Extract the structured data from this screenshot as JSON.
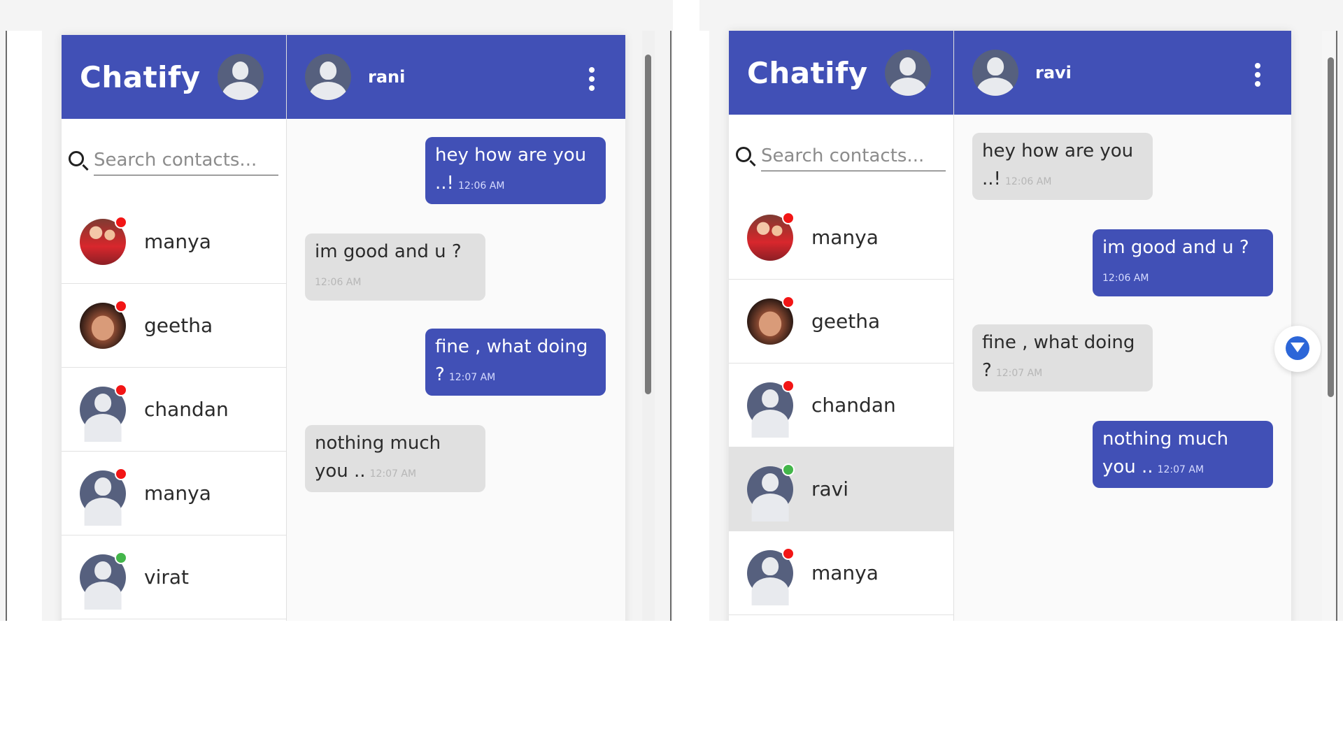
{
  "windows": [
    {
      "app": {
        "title": "Chatify",
        "search_placeholder": "Search contacts...",
        "chat_name": "rani",
        "contacts": [
          {
            "name": "manya",
            "status": "offline",
            "avatar": "photo-a"
          },
          {
            "name": "geetha",
            "status": "offline",
            "avatar": "photo-b"
          },
          {
            "name": "chandan",
            "status": "offline",
            "avatar": "default"
          },
          {
            "name": "manya",
            "status": "offline",
            "avatar": "default"
          },
          {
            "name": "virat",
            "status": "online",
            "avatar": "default"
          }
        ],
        "messages": [
          {
            "text": "hey how are you ..!",
            "time": "12:06 AM",
            "side": "sent"
          },
          {
            "text": "im good and u ?",
            "time": "12:06 AM",
            "side": "recv"
          },
          {
            "text": "fine , what doing ?",
            "time": "12:07 AM",
            "side": "sent"
          },
          {
            "text": "nothing much you ..",
            "time": "12:07 AM",
            "side": "recv"
          }
        ]
      }
    },
    {
      "app": {
        "title": "Chatify",
        "search_placeholder": "Search contacts...",
        "chat_name": "ravi",
        "contacts": [
          {
            "name": "manya",
            "status": "offline",
            "avatar": "photo-a"
          },
          {
            "name": "geetha",
            "status": "offline",
            "avatar": "photo-b"
          },
          {
            "name": "chandan",
            "status": "offline",
            "avatar": "default"
          },
          {
            "name": "ravi",
            "status": "online",
            "avatar": "default",
            "active": true
          },
          {
            "name": "manya",
            "status": "offline",
            "avatar": "default"
          }
        ],
        "messages": [
          {
            "text": "hey how are you ..!",
            "time": "12:06 AM",
            "side": "recv"
          },
          {
            "text": "im good and u ?",
            "time": "12:06 AM",
            "side": "sent"
          },
          {
            "text": "fine , what doing ?",
            "time": "12:07 AM",
            "side": "recv"
          },
          {
            "text": "nothing much you ..",
            "time": "12:07 AM",
            "side": "sent"
          }
        ]
      }
    }
  ],
  "colors": {
    "primary": "#4150b6",
    "sent_bubble": "#4150b6",
    "received_bubble": "#e0e0e0",
    "online": "#43b64a",
    "offline": "#f21515"
  }
}
